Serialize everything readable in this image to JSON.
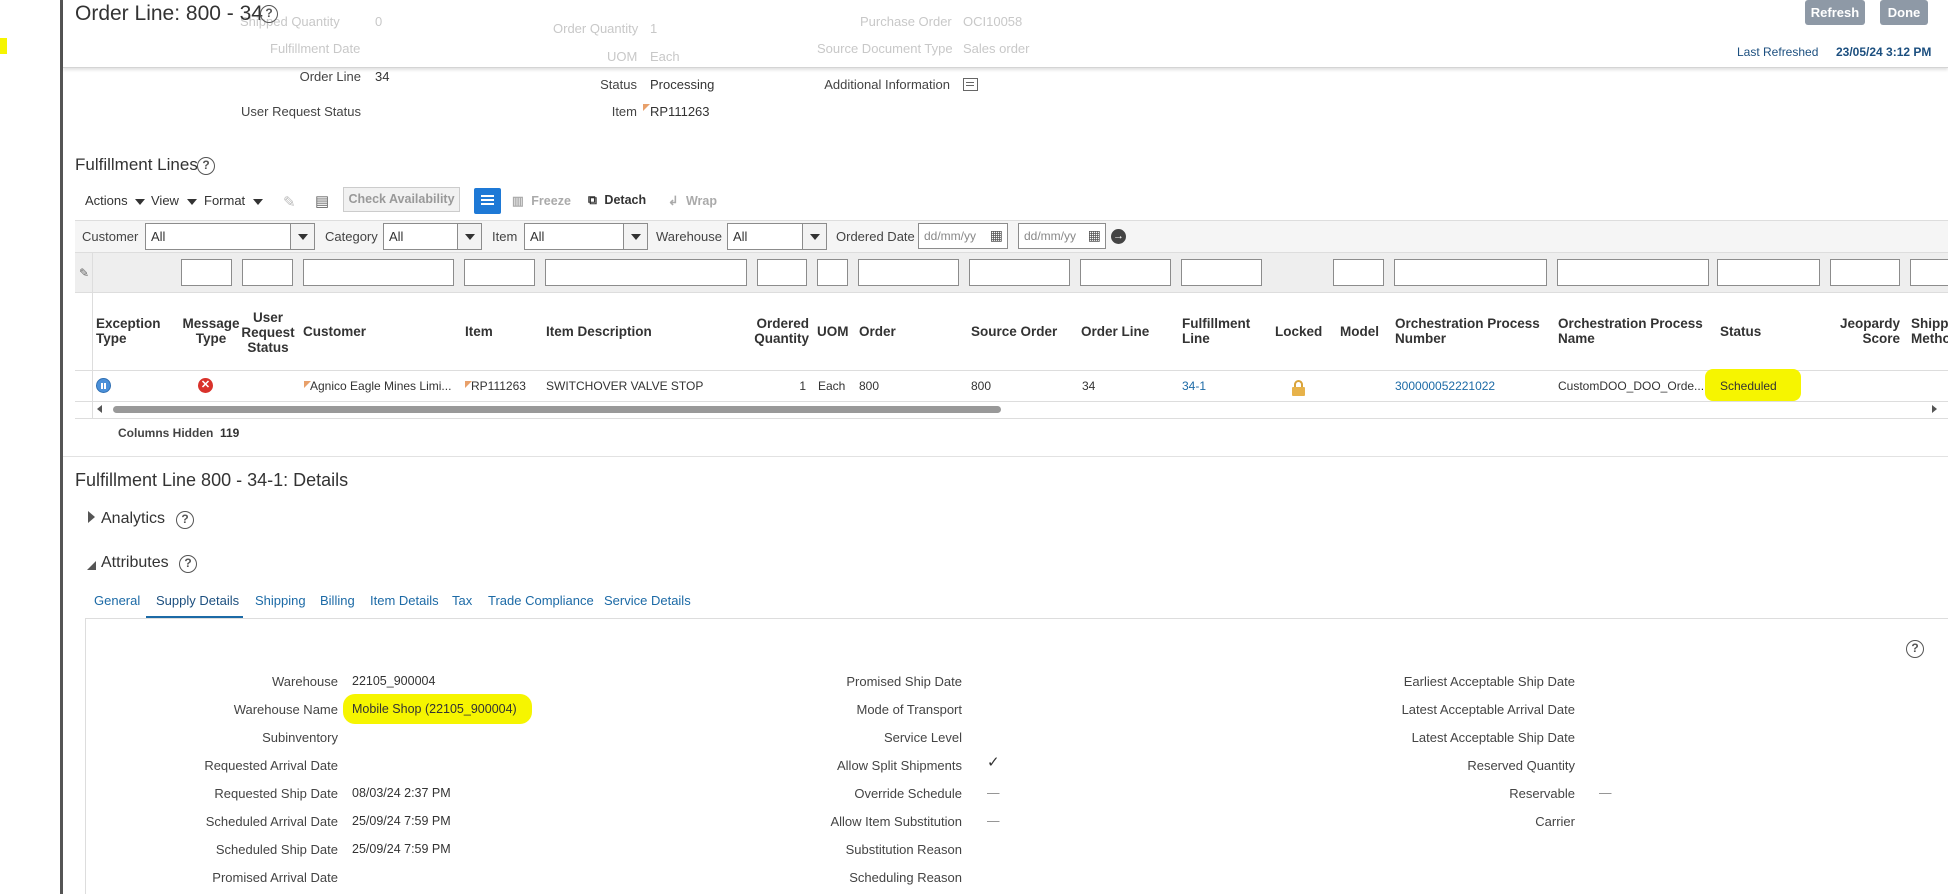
{
  "header": {
    "title": "Order Line: 800 - 34",
    "refresh_label": "Refresh",
    "done_label": "Done",
    "last_refreshed_label": "Last Refreshed",
    "last_refreshed_value": "23/05/24 3:12 PM",
    "ghost": {
      "shipped_quantity": "Shipped Quantity",
      "shipped_value": "0",
      "order_quantity": "Order Quantity",
      "order_quantity_value": "1",
      "fulfillment_date": "Fulfillment Date",
      "uom": "UOM",
      "uom_value": "Each",
      "purchase_order": "Purchase Order",
      "purchase_order_value": "OCI10058",
      "source_doc_type": "Source Document Type",
      "source_doc_type_value": "Sales order"
    },
    "order_line_label": "Order Line",
    "order_line_value": "34",
    "status_label": "Status",
    "status_value": "Processing",
    "additional_info_label": "Additional Information",
    "user_request_status_label": "User Request Status",
    "item_label": "Item",
    "item_value": "RP111263"
  },
  "fulfillment_lines": {
    "title": "Fulfillment Lines",
    "toolbar": {
      "actions": "Actions",
      "view": "View",
      "format": "Format",
      "check_availability": "Check Availability",
      "freeze": "Freeze",
      "detach": "Detach",
      "wrap": "Wrap"
    },
    "filters": {
      "customer_label": "Customer",
      "customer_value": "All",
      "category_label": "Category",
      "category_value": "All",
      "item_label": "Item",
      "item_value": "All",
      "warehouse_label": "Warehouse",
      "warehouse_value": "All",
      "ordered_date_label": "Ordered Date",
      "date_placeholder": "dd/mm/yy"
    },
    "columns": {
      "exception_type": "Exception Type",
      "message_type": "Message Type",
      "user_request_status": "User Request Status",
      "customer": "Customer",
      "item": "Item",
      "item_description": "Item Description",
      "ordered_quantity": "Ordered Quantity",
      "uom": "UOM",
      "order": "Order",
      "source_order": "Source Order",
      "order_line": "Order Line",
      "fulfillment_line": "Fulfillment Line",
      "locked": "Locked",
      "model": "Model",
      "orch_process_number": "Orchestration Process Number",
      "orch_process_name": "Orchestration Process Name",
      "status": "Status",
      "jeopardy_score": "Jeopardy Score",
      "shipping_method": "Shipp Metho"
    },
    "row": {
      "customer": "Agnico Eagle Mines Limi...",
      "item": "RP111263",
      "item_description": "SWITCHOVER VALVE STOP",
      "ordered_quantity": "1",
      "uom": "Each",
      "order": "800",
      "source_order": "800",
      "order_line": "34",
      "fulfillment_line": "34-1",
      "orch_process_number": "300000052221022",
      "orch_process_name": "CustomDOO_DOO_Orde...",
      "status": "Scheduled"
    },
    "columns_hidden_label": "Columns Hidden",
    "columns_hidden_value": "119"
  },
  "details": {
    "title": "Fulfillment Line 800 - 34-1: Details",
    "analytics": "Analytics",
    "attributes": "Attributes",
    "tabs": [
      "General",
      "Supply Details",
      "Shipping",
      "Billing",
      "Item Details",
      "Tax",
      "Trade Compliance",
      "Service Details"
    ],
    "col1": [
      {
        "label": "Warehouse",
        "value": "22105_900004"
      },
      {
        "label": "Warehouse Name",
        "value": "Mobile Shop (22105_900004)"
      },
      {
        "label": "Subinventory",
        "value": ""
      },
      {
        "label": "Requested Arrival Date",
        "value": ""
      },
      {
        "label": "Requested Ship Date",
        "value": "08/03/24 2:37 PM"
      },
      {
        "label": "Scheduled Arrival Date",
        "value": "25/09/24 7:59 PM"
      },
      {
        "label": "Scheduled Ship Date",
        "value": "25/09/24 7:59 PM"
      },
      {
        "label": "Promised Arrival Date",
        "value": ""
      }
    ],
    "col2": [
      {
        "label": "Promised Ship Date",
        "value": ""
      },
      {
        "label": "Mode of Transport",
        "value": ""
      },
      {
        "label": "Service Level",
        "value": ""
      },
      {
        "label": "Allow Split Shipments",
        "value": "✓"
      },
      {
        "label": "Override Schedule",
        "value": "—"
      },
      {
        "label": "Allow Item Substitution",
        "value": "—"
      },
      {
        "label": "Substitution Reason",
        "value": ""
      },
      {
        "label": "Scheduling Reason",
        "value": ""
      }
    ],
    "col3": [
      {
        "label": "Earliest Acceptable Ship Date",
        "value": ""
      },
      {
        "label": "Latest Acceptable Arrival Date",
        "value": ""
      },
      {
        "label": "Latest Acceptable Ship Date",
        "value": ""
      },
      {
        "label": "Reserved Quantity",
        "value": ""
      },
      {
        "label": "Reservable",
        "value": "—"
      },
      {
        "label": "Carrier",
        "value": ""
      }
    ]
  }
}
